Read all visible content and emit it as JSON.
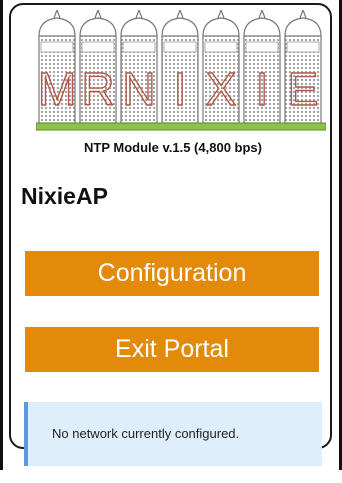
{
  "header": {
    "logo_icon": "mr-nixie-logo",
    "logo_text": "MRNIXIE",
    "module_label": "NTP Module v.1.5 (4,800 bps)"
  },
  "main": {
    "title": "NixieAP",
    "buttons": {
      "configuration_label": "Configuration",
      "exit_label": "Exit Portal"
    },
    "status_message": "No network currently configured."
  },
  "colors": {
    "button_bg": "#e48a0b",
    "message_bg": "#dfeefb",
    "message_border": "#5b9bd5",
    "tube_text": "#b05a4a",
    "base_green": "#8bc34a"
  }
}
